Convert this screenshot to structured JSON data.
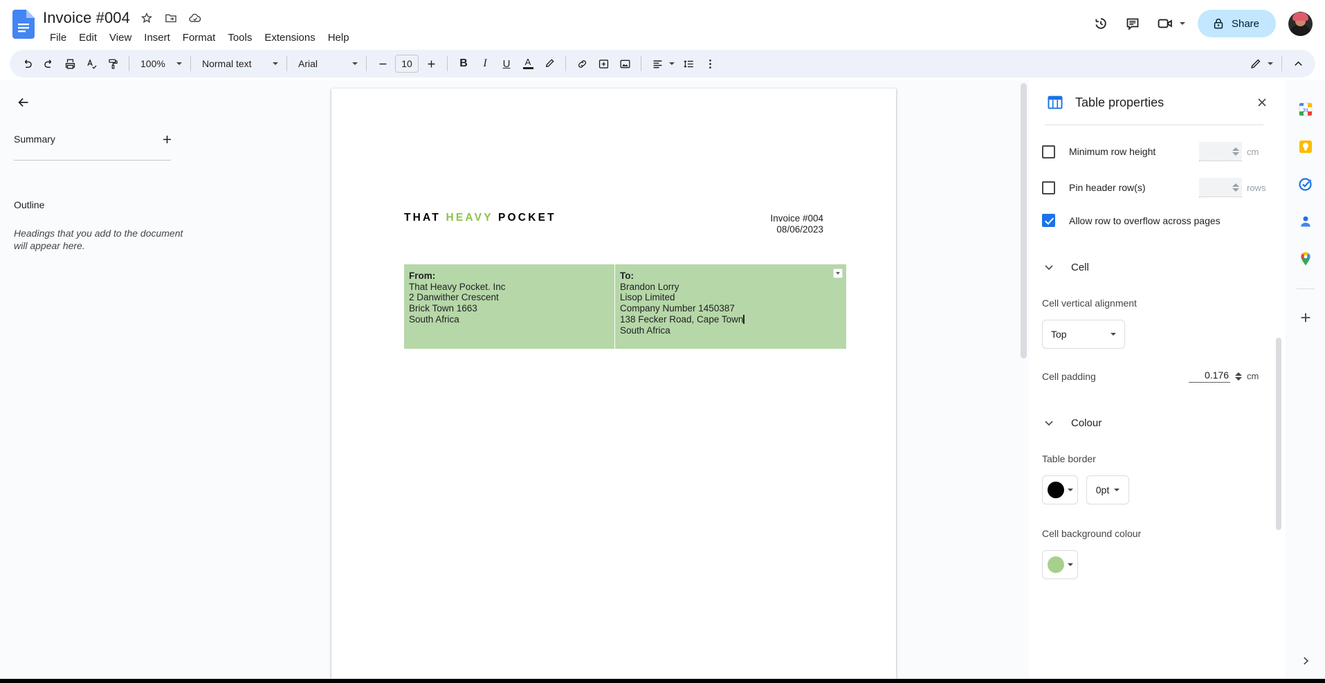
{
  "window": {
    "doc_title": "Invoice #004",
    "doc_icon": "google-docs-icon"
  },
  "title_actions": [
    {
      "name": "star-icon",
      "glyph": "☆"
    },
    {
      "name": "move-to-folder-icon",
      "glyph": "folder"
    },
    {
      "name": "cloud-saved-icon",
      "glyph": "cloud"
    }
  ],
  "menubar": {
    "items": [
      {
        "label": "File"
      },
      {
        "label": "Edit"
      },
      {
        "label": "View"
      },
      {
        "label": "Insert"
      },
      {
        "label": "Format"
      },
      {
        "label": "Tools"
      },
      {
        "label": "Extensions"
      },
      {
        "label": "Help"
      }
    ]
  },
  "top_right": {
    "history_icon": "version-history-icon",
    "comments_icon": "comment-icon",
    "meet_icon": "video-camera-icon",
    "share_label": "Share",
    "share_icon": "lock-icon",
    "avatar": "user-avatar"
  },
  "toolbar": {
    "undo_icon": "undo-icon",
    "redo_icon": "redo-icon",
    "print_icon": "print-icon",
    "spellcheck_icon": "spellcheck-icon",
    "paint_format_icon": "paint-format-icon",
    "zoom_value": "100%",
    "paragraph_style": "Normal text",
    "font_family": "Arial",
    "font_size": "10",
    "decrease_font_icon": "minus-icon",
    "increase_font_icon": "plus-icon",
    "bold_label": "B",
    "italic_label": "I",
    "underline_label": "U",
    "text_colour_label": "A",
    "highlight_icon": "highlighter-icon",
    "link_icon": "link-icon",
    "comment_add_icon": "add-comment-icon",
    "image_icon": "insert-image-icon",
    "align_icon": "align-left-icon",
    "line_spacing_icon": "line-spacing-icon",
    "more_icon": "more-options-icon",
    "editing_mode_icon": "pencil-icon",
    "collapse_icon": "collapse-toolbar-icon"
  },
  "sidebar": {
    "back_icon": "back-arrow-icon",
    "summary_label": "Summary",
    "add_summary_icon": "plus-icon",
    "outline_label": "Outline",
    "outline_empty_text": "Headings that you add to the document will appear here."
  },
  "document": {
    "logo": {
      "part1": "THAT",
      "part2": "HEAVY",
      "part3": "POCKET",
      "accent_colour": "#8bc34a"
    },
    "invoice_number": "Invoice #004",
    "invoice_date": "08/06/2023",
    "table": {
      "background_colour": "#b6d7a8",
      "from_cell": {
        "heading": "From:",
        "lines": [
          "That Heavy Pocket. Inc",
          "2 Danwither Crescent",
          "Brick Town 1663",
          "South Africa"
        ]
      },
      "to_cell": {
        "heading": "To:",
        "lines": [
          "Brandon Lorry",
          "Lisop Limited",
          "Company Number 1450387",
          "138 Fecker Road, Cape Town",
          "South Africa"
        ],
        "cursor_after_line_index": 3
      },
      "cell_handle_icon": "cell-options-dropdown-icon"
    }
  },
  "panel": {
    "title": "Table properties",
    "title_icon": "table-icon",
    "close_icon": "close-icon",
    "row_options": [
      {
        "label": "Minimum row height",
        "checked": false,
        "value": "",
        "unit": "cm",
        "name": "minimum-row-height"
      },
      {
        "label": "Pin header row(s)",
        "checked": false,
        "value": "",
        "unit": "rows",
        "name": "pin-header-rows"
      },
      {
        "label": "Allow row to overflow across pages",
        "checked": true,
        "name": "allow-row-overflow"
      }
    ],
    "cell_section": {
      "title": "Cell",
      "expanded": true,
      "vertical_alignment_label": "Cell vertical alignment",
      "vertical_alignment_value": "Top",
      "padding_label": "Cell padding",
      "padding_value": "0.176",
      "padding_unit": "cm"
    },
    "colour_section": {
      "title": "Colour",
      "expanded": true,
      "table_border_label": "Table border",
      "table_border_colour": "#000000",
      "table_border_width": "0pt",
      "cell_background_label": "Cell background colour",
      "cell_background_colour": "#a8d08d"
    }
  },
  "rail": {
    "items": [
      {
        "name": "google-calendar-icon",
        "label": "31"
      },
      {
        "name": "google-keep-icon",
        "label": ""
      },
      {
        "name": "google-tasks-icon",
        "label": ""
      },
      {
        "name": "google-contacts-icon",
        "label": ""
      },
      {
        "name": "google-maps-icon",
        "label": ""
      }
    ],
    "add_icon": "add-on-plus-icon",
    "expand_icon": "expand-rail-icon"
  }
}
